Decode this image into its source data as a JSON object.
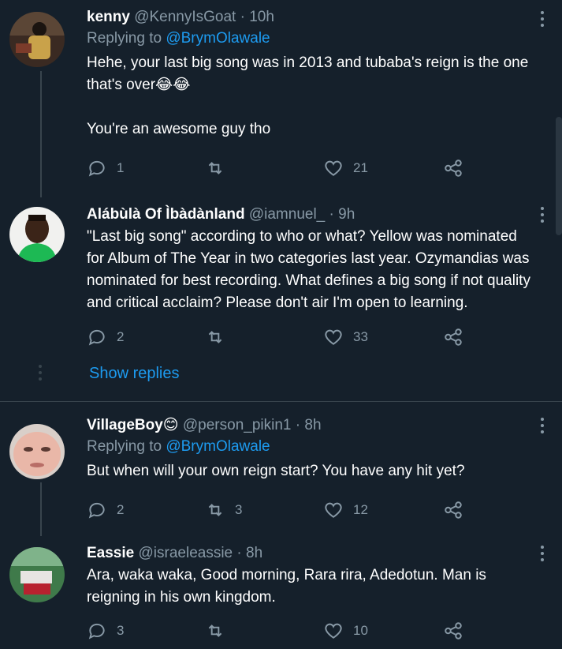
{
  "tweets": [
    {
      "name": "kenny",
      "handle": "@KennyIsGoat",
      "time": "· 10h",
      "replying_prefix": "Replying to",
      "replying_handle": "@BrymOlawale",
      "text1": "Hehe, your last big song was in 2013 and tubaba's reign is the one that's over😂😂",
      "text2": "You're an awesome guy tho",
      "reply_count": "1",
      "retweet_count": "",
      "like_count": "21"
    },
    {
      "name": "Alábùlà Of Ìbàdànland",
      "handle": "@iamnuel_",
      "time": "· 9h",
      "text1": "\"Last big song\" according to who or what? Yellow was nominated for Album of The Year in two categories last year. Ozymandias was nominated for best recording. What defines a big song if not quality and critical acclaim? Please don't air I'm open to learning.",
      "reply_count": "2",
      "retweet_count": "",
      "like_count": "33",
      "show_replies": "Show replies"
    },
    {
      "name": "VillageBoy😊",
      "handle": "@person_pikin1",
      "time": "· 8h",
      "replying_prefix": "Replying to",
      "replying_handle": "@BrymOlawale",
      "text1": "But when will your own reign start? You have any hit yet?",
      "reply_count": "2",
      "retweet_count": "3",
      "like_count": "12"
    },
    {
      "name": "Eassie",
      "handle": "@israeleassie",
      "time": "· 8h",
      "text1": "Ara, waka waka, Good morning, Rara rira, Adedotun. Man is reigning in his own kingdom.",
      "reply_count": "3",
      "retweet_count": "",
      "like_count": "10"
    }
  ],
  "icons": {
    "reply": "reply-icon",
    "retweet": "retweet-icon",
    "like": "heart-icon",
    "share": "share-icon",
    "more": "more-icon"
  },
  "colors": {
    "background": "#15202b",
    "text": "#ffffff",
    "muted": "#8899a6",
    "link": "#1d9bf0",
    "divider": "#38444d"
  }
}
